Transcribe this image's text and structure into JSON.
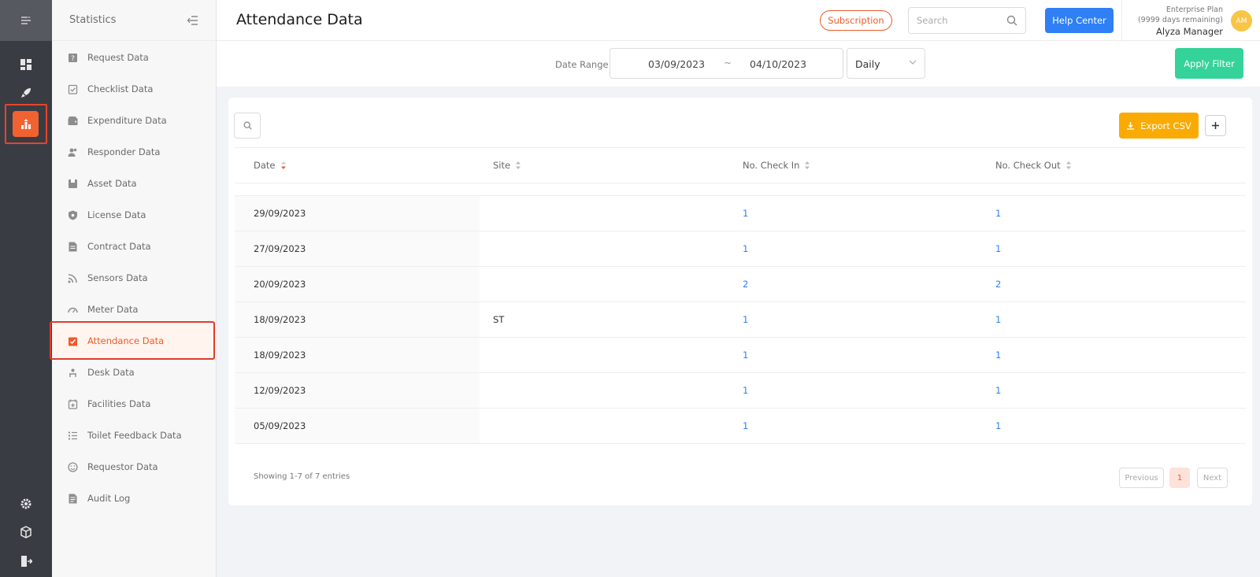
{
  "rail": {
    "icons": [
      "menu-icon",
      "dashboard-icon",
      "rocket-icon",
      "statistics-icon",
      "settings-icon",
      "box-icon",
      "logout-icon"
    ]
  },
  "sidebar": {
    "title": "Statistics",
    "items": [
      {
        "label": "Request Data",
        "icon": "request-icon"
      },
      {
        "label": "Checklist Data",
        "icon": "checklist-icon"
      },
      {
        "label": "Expenditure Data",
        "icon": "wallet-icon"
      },
      {
        "label": "Responder Data",
        "icon": "users-icon"
      },
      {
        "label": "Asset Data",
        "icon": "asset-icon"
      },
      {
        "label": "License Data",
        "icon": "shield-icon"
      },
      {
        "label": "Contract Data",
        "icon": "contract-icon"
      },
      {
        "label": "Sensors Data",
        "icon": "sensor-icon"
      },
      {
        "label": "Meter Data",
        "icon": "meter-icon"
      },
      {
        "label": "Attendance Data",
        "icon": "attendance-icon",
        "active": true
      },
      {
        "label": "Desk Data",
        "icon": "desk-icon"
      },
      {
        "label": "Facilities Data",
        "icon": "facilities-icon"
      },
      {
        "label": "Toilet Feedback Data",
        "icon": "list-icon"
      },
      {
        "label": "Requestor Data",
        "icon": "smile-icon"
      },
      {
        "label": "Audit Log",
        "icon": "audit-icon"
      }
    ]
  },
  "header": {
    "title": "Attendance Data",
    "subscription_label": "Subscription",
    "search_placeholder": "Search",
    "help_label": "Help Center",
    "plan_name": "Enterprise Plan",
    "plan_remaining": "(9999 days remaining)",
    "user_name": "Alyza Manager",
    "avatar_initials": "AM"
  },
  "filter": {
    "date_range_label": "Date Range",
    "start_date": "03/09/2023",
    "separator": "~",
    "end_date": "04/10/2023",
    "period": "Daily",
    "apply_label": "Apply Filter"
  },
  "table": {
    "export_label": "Export CSV",
    "columns": [
      "Date",
      "Site",
      "No. Check In",
      "No. Check Out"
    ],
    "rows": [
      {
        "date": "29/09/2023",
        "site": "",
        "check_in": "1",
        "check_out": "1"
      },
      {
        "date": "27/09/2023",
        "site": "",
        "check_in": "1",
        "check_out": "1"
      },
      {
        "date": "20/09/2023",
        "site": "",
        "check_in": "2",
        "check_out": "2"
      },
      {
        "date": "18/09/2023",
        "site": "ST",
        "check_in": "1",
        "check_out": "1"
      },
      {
        "date": "18/09/2023",
        "site": "",
        "check_in": "1",
        "check_out": "1"
      },
      {
        "date": "12/09/2023",
        "site": "",
        "check_in": "1",
        "check_out": "1"
      },
      {
        "date": "05/09/2023",
        "site": "",
        "check_in": "1",
        "check_out": "1"
      }
    ],
    "info": "Showing 1-7 of 7 entries",
    "pagination": {
      "previous": "Previous",
      "current": "1",
      "next": "Next"
    }
  },
  "colors": {
    "accent_orange": "#f05a28",
    "primary_blue": "#2f7ff5",
    "apply_green": "#34d399",
    "export_yellow": "#f9ab04"
  }
}
